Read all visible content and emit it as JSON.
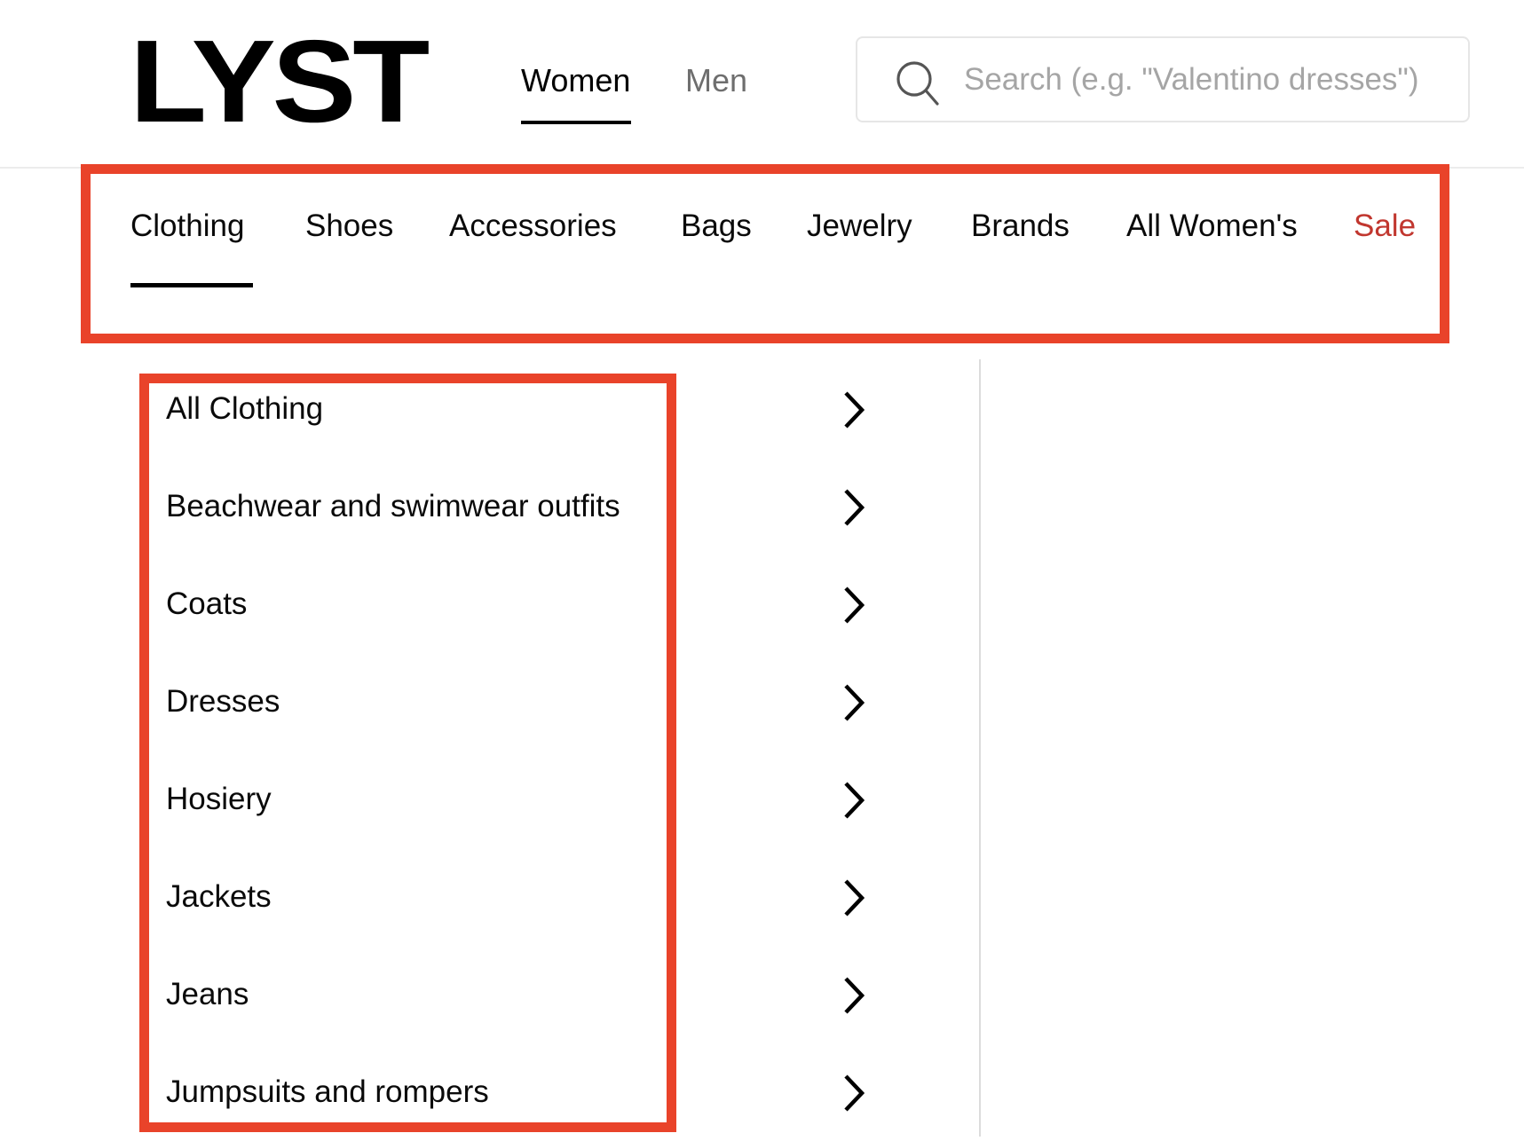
{
  "header": {
    "logo": "LYST",
    "gender_tabs": [
      {
        "label": "Women",
        "active": true
      },
      {
        "label": "Men",
        "active": false
      }
    ],
    "search": {
      "placeholder": "Search (e.g. \"Valentino dresses\")",
      "value": "",
      "icon": "search-icon"
    }
  },
  "category_nav": {
    "items": [
      {
        "label": "Clothing",
        "active": true
      },
      {
        "label": "Shoes"
      },
      {
        "label": "Accessories"
      },
      {
        "label": "Bags"
      },
      {
        "label": "Jewelry"
      },
      {
        "label": "Brands"
      },
      {
        "label": "All Women's"
      },
      {
        "label": "Sale",
        "highlight": true
      }
    ]
  },
  "subcategories": {
    "items": [
      {
        "label": "All Clothing",
        "icon": "chevron-right-icon"
      },
      {
        "label": "Beachwear and swimwear outfits",
        "icon": "chevron-right-icon"
      },
      {
        "label": "Coats",
        "icon": "chevron-right-icon"
      },
      {
        "label": "Dresses",
        "icon": "chevron-right-icon"
      },
      {
        "label": "Hosiery",
        "icon": "chevron-right-icon"
      },
      {
        "label": "Jackets",
        "icon": "chevron-right-icon"
      },
      {
        "label": "Jeans",
        "icon": "chevron-right-icon"
      },
      {
        "label": "Jumpsuits and rompers",
        "icon": "chevron-right-icon"
      }
    ]
  },
  "colors": {
    "annotation_red": "#e9432a",
    "sale_red": "#c1372f",
    "text": "#0a0a0a",
    "muted": "#6e6e6e",
    "placeholder": "#a5a5a5"
  }
}
